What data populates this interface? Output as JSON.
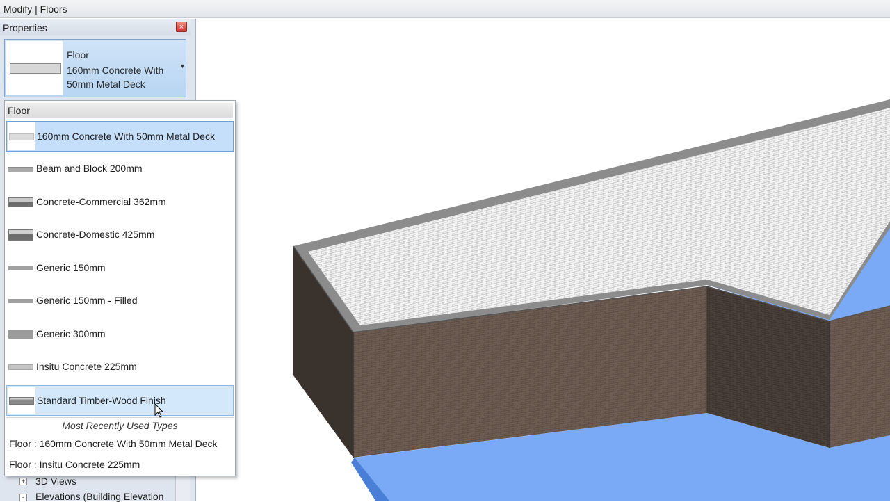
{
  "window": {
    "title": "Modify | Floors"
  },
  "properties": {
    "header": "Properties",
    "close_glyph": "×",
    "type_selector": {
      "family": "Floor",
      "type_name": "160mm Concrete With 50mm Metal Deck",
      "dropdown_glyph": "▼"
    }
  },
  "project_browser": {
    "rows": [
      {
        "label": "3D Views",
        "expander": "+"
      },
      {
        "label": "Elevations (Building Elevation",
        "expander": "-"
      }
    ]
  },
  "type_dropdown": {
    "group_label": "Floor",
    "items": [
      {
        "label": "160mm Concrete With 50mm Metal Deck",
        "state": "selected",
        "swatch": "light"
      },
      {
        "label": "Beam and Block 200mm",
        "state": "normal",
        "swatch": "thin-mid"
      },
      {
        "label": "Concrete-Commercial 362mm",
        "state": "normal",
        "swatch": "thick-dark"
      },
      {
        "label": "Concrete-Domestic 425mm",
        "state": "normal",
        "swatch": "thick-dark"
      },
      {
        "label": "Generic 150mm",
        "state": "normal",
        "swatch": "thin-mid"
      },
      {
        "label": "Generic 150mm - Filled",
        "state": "normal",
        "swatch": "thin-mid"
      },
      {
        "label": "Generic 300mm",
        "state": "normal",
        "swatch": "medium-mid"
      },
      {
        "label": "Insitu Concrete 225mm",
        "state": "normal",
        "swatch": "thin-light"
      },
      {
        "label": "Standard Timber-Wood Finish",
        "state": "hover",
        "swatch": "medium-dark"
      }
    ],
    "mru_header": "Most Recently Used Types",
    "mru_items": [
      "Floor : 160mm Concrete With 50mm Metal Deck",
      "Floor : Insitu Concrete 225mm"
    ]
  },
  "colors": {
    "selection_fill": "#c5defa",
    "hover_fill": "#d4e8fb",
    "floor_blue": "#7aaaf5",
    "brick_wall": "#6b5a50",
    "dark_wall": "#3a322d"
  }
}
